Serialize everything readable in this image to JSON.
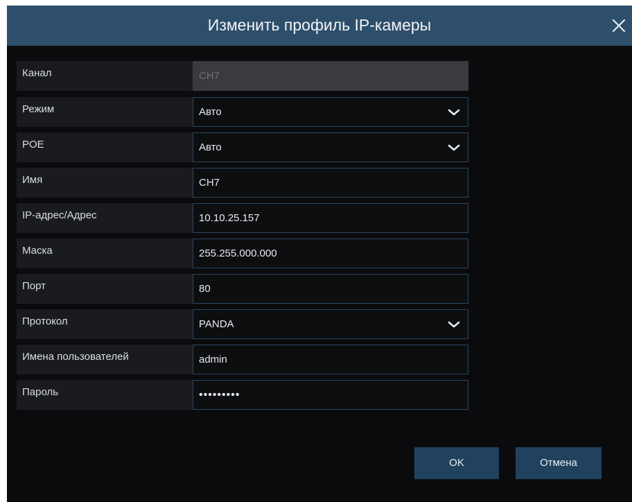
{
  "dialog": {
    "title": "Изменить профиль IP-камеры",
    "close_icon": "close-icon"
  },
  "form": {
    "channel": {
      "label": "Канал",
      "value": "CH7"
    },
    "mode": {
      "label": "Режим",
      "value": "Авто",
      "icon": "chevron-down-icon"
    },
    "poe": {
      "label": "POE",
      "value": "Авто",
      "icon": "chevron-down-icon"
    },
    "name": {
      "label": "Имя",
      "value": "CH7"
    },
    "ip": {
      "label": "IP-адрес/Адрес",
      "value": "10.10.25.157"
    },
    "mask": {
      "label": "Маска",
      "value": "255.255.000.000"
    },
    "port": {
      "label": "Порт",
      "value": "80"
    },
    "protocol": {
      "label": "Протокол",
      "value": "PANDA",
      "icon": "chevron-down-icon"
    },
    "username": {
      "label": "Имена пользователей",
      "value": "admin"
    },
    "password": {
      "label": "Пароль",
      "value": "•••••••••"
    }
  },
  "buttons": {
    "ok": "OK",
    "cancel": "Отмена"
  },
  "colors": {
    "titlebar": "#2e4f6b",
    "background": "#0b0b0d",
    "row": "#1a1b1e",
    "field_border": "#294664",
    "button": "#21425f"
  }
}
